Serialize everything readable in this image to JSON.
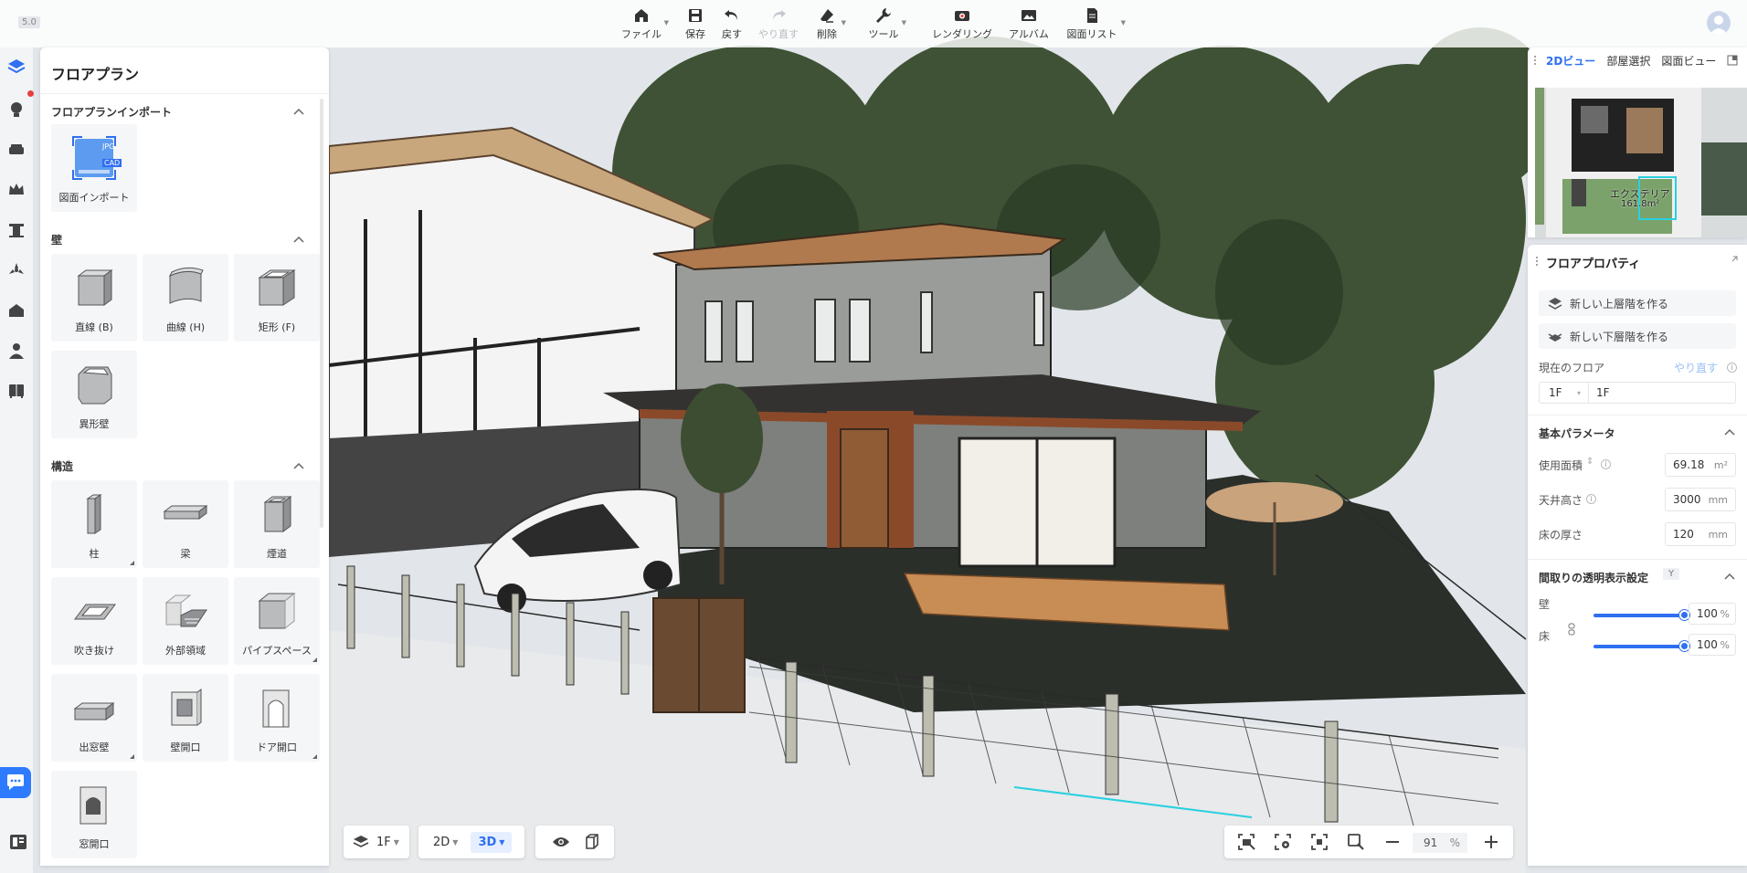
{
  "app": {
    "version": "5.0"
  },
  "toolbar": {
    "file": "ファイル",
    "save": "保存",
    "undo": "戻す",
    "redo": "やり直す",
    "delete": "削除",
    "tools": "ツール",
    "render": "レンダリング",
    "album": "アルバム",
    "drawing_list": "図面リスト"
  },
  "left_panel": {
    "title": "フロアプラン",
    "sections": {
      "import": {
        "title": "フロアプランインポート",
        "items": [
          "図面インポート"
        ]
      },
      "wall": {
        "title": "壁",
        "items": [
          "直線 (B)",
          "曲線 (H)",
          "矩形 (F)",
          "異形壁"
        ]
      },
      "structure": {
        "title": "構造",
        "items": [
          "柱",
          "梁",
          "煙道",
          "吹き抜け",
          "外部領域",
          "パイプスペース",
          "出窓壁",
          "壁開口",
          "ドア開口",
          "窓開口"
        ]
      }
    },
    "import_badges": {
      "jpg": "JPG",
      "cad": "CAD"
    }
  },
  "bottom_controls": {
    "floor": "1F",
    "view2d": "2D",
    "view3d": "3D"
  },
  "zoom": {
    "value": "91",
    "unit": "%"
  },
  "minimap": {
    "tabs": [
      "2Dビュー",
      "部屋選択",
      "図面ビュー"
    ],
    "room_label": "エクステリア",
    "room_area": "161.8m²"
  },
  "properties": {
    "title": "フロアプロパティ",
    "new_upper": "新しい上層階を作る",
    "new_lower": "新しい下層階を作る",
    "current_floor_label": "現在のフロア",
    "redo_link": "やり直す",
    "floor_code": "1F",
    "floor_name": "1F",
    "basic_params": "基本パラメータ",
    "area_label": "使用面積",
    "area_value": "69.18",
    "area_unit": "m²",
    "ceiling_label": "天井高さ",
    "ceiling_value": "3000",
    "ceiling_unit": "mm",
    "floor_thick_label": "床の厚さ",
    "floor_thick_value": "120",
    "floor_thick_unit": "mm",
    "transparency_title": "間取りの透明表示設定",
    "transparency_key": "Y",
    "wall_label": "壁",
    "wall_value": "100",
    "floor_label": "床",
    "floor_value": "100",
    "percent": "%"
  }
}
